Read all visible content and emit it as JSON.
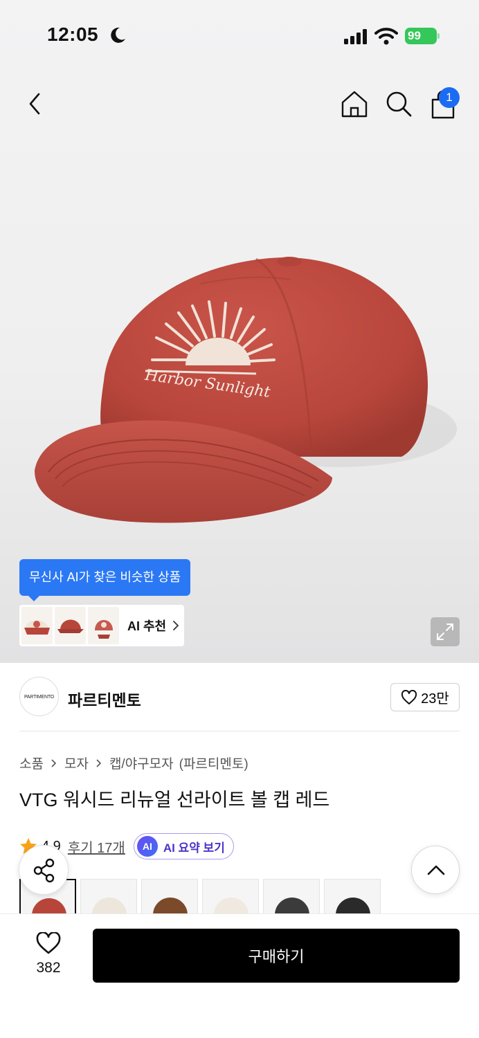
{
  "status_bar": {
    "time": "12:05",
    "battery": "99"
  },
  "header": {
    "cart_count": "1"
  },
  "ai_similar": {
    "tooltip": "무신사 AI가 찾은 비슷한 상품",
    "recommend_label": "AI 추천"
  },
  "brand": {
    "logo_text": "PARTIMENTO",
    "name": "파르티멘토",
    "likes": "23만"
  },
  "breadcrumb": {
    "items": [
      "소품",
      "모자",
      "캡/야구모자"
    ],
    "brand_suffix": "(파르티멘토)"
  },
  "product": {
    "title": "VTG 워시드 리뉴얼 선라이트 볼 캡 레드",
    "rating": "4.9",
    "review_link": "후기 17개",
    "ai_badge": "AI",
    "ai_summary": "AI 요약 보기",
    "rating_color": "#f7a318"
  },
  "color_options": [
    {
      "name": "red",
      "color": "#b8453a"
    },
    {
      "name": "cream",
      "color": "#ece6dc"
    },
    {
      "name": "brown",
      "color": "#7b4a2a"
    },
    {
      "name": "ivory",
      "color": "#efe9df"
    },
    {
      "name": "charcoal",
      "color": "#3b3b3b"
    },
    {
      "name": "black",
      "color": "#2a2a2a"
    }
  ],
  "bottom_bar": {
    "like_count": "382",
    "buy_label": "구매하기"
  },
  "colors": {
    "accent_blue": "#1c6bf3",
    "tooltip_blue": "#2b78f5",
    "battery_green": "#34c759",
    "buy_black": "#000000"
  }
}
